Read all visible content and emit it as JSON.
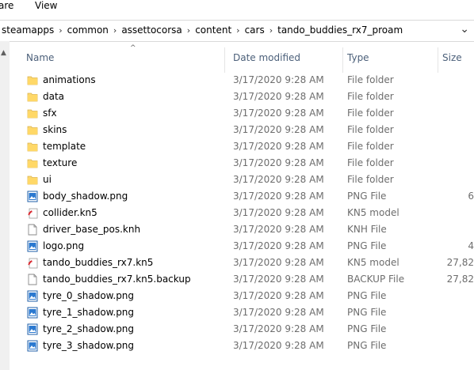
{
  "ribbon": {
    "tab_share": "are",
    "tab_view": "View"
  },
  "breadcrumb": {
    "items": [
      "steamapps",
      "common",
      "assettocorsa",
      "content",
      "cars",
      "tando_buddies_rx7_proam"
    ],
    "separator": "›"
  },
  "address_dropdown": "⌄",
  "headers": {
    "name": "Name",
    "date": "Date modified",
    "type": "Type",
    "size": "Size"
  },
  "files": [
    {
      "name": "animations",
      "date": "3/17/2020 9:28 AM",
      "type": "File folder",
      "size": "",
      "icon": "folder-icon"
    },
    {
      "name": "data",
      "date": "3/17/2020 9:28 AM",
      "type": "File folder",
      "size": "",
      "icon": "folder-icon"
    },
    {
      "name": "sfx",
      "date": "3/17/2020 9:28 AM",
      "type": "File folder",
      "size": "",
      "icon": "folder-icon"
    },
    {
      "name": "skins",
      "date": "3/17/2020 9:28 AM",
      "type": "File folder",
      "size": "",
      "icon": "folder-icon"
    },
    {
      "name": "template",
      "date": "3/17/2020 9:28 AM",
      "type": "File folder",
      "size": "",
      "icon": "folder-icon"
    },
    {
      "name": "texture",
      "date": "3/17/2020 9:28 AM",
      "type": "File folder",
      "size": "",
      "icon": "folder-icon"
    },
    {
      "name": "ui",
      "date": "3/17/2020 9:28 AM",
      "type": "File folder",
      "size": "",
      "icon": "folder-icon"
    },
    {
      "name": "body_shadow.png",
      "date": "3/17/2020 9:28 AM",
      "type": "PNG File",
      "size": "6",
      "icon": "image-file-icon"
    },
    {
      "name": "collider.kn5",
      "date": "3/17/2020 9:28 AM",
      "type": "KN5 model",
      "size": "",
      "icon": "kn5-model-icon"
    },
    {
      "name": "driver_base_pos.knh",
      "date": "3/17/2020 9:28 AM",
      "type": "KNH File",
      "size": "",
      "icon": "blank-file-icon"
    },
    {
      "name": "logo.png",
      "date": "3/17/2020 9:28 AM",
      "type": "PNG File",
      "size": "4",
      "icon": "image-file-icon"
    },
    {
      "name": "tando_buddies_rx7.kn5",
      "date": "3/17/2020 9:28 AM",
      "type": "KN5 model",
      "size": "27,82",
      "icon": "kn5-model-icon"
    },
    {
      "name": "tando_buddies_rx7.kn5.backup",
      "date": "3/17/2020 9:28 AM",
      "type": "BACKUP File",
      "size": "27,82",
      "icon": "blank-file-icon"
    },
    {
      "name": "tyre_0_shadow.png",
      "date": "3/17/2020 9:28 AM",
      "type": "PNG File",
      "size": "",
      "icon": "image-file-icon"
    },
    {
      "name": "tyre_1_shadow.png",
      "date": "3/17/2020 9:28 AM",
      "type": "PNG File",
      "size": "",
      "icon": "image-file-icon"
    },
    {
      "name": "tyre_2_shadow.png",
      "date": "3/17/2020 9:28 AM",
      "type": "PNG File",
      "size": "",
      "icon": "image-file-icon"
    },
    {
      "name": "tyre_3_shadow.png",
      "date": "3/17/2020 9:28 AM",
      "type": "PNG File",
      "size": "",
      "icon": "image-file-icon"
    }
  ]
}
